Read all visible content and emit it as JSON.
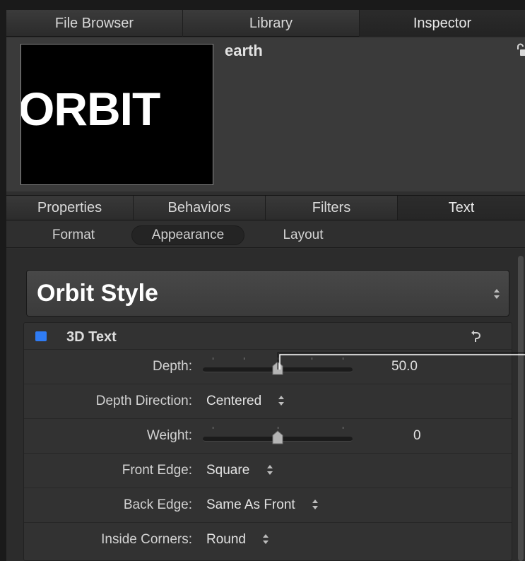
{
  "top_tabs": [
    {
      "label": "File Browser",
      "active": false
    },
    {
      "label": "Library",
      "active": false
    },
    {
      "label": "Inspector",
      "active": true
    }
  ],
  "preview": {
    "thumbnail_text": "ORBIT",
    "object_name": "earth",
    "lock_icon": "padlock-open-icon"
  },
  "pane_tabs": [
    {
      "label": "Properties",
      "active": false
    },
    {
      "label": "Behaviors",
      "active": false
    },
    {
      "label": "Filters",
      "active": false
    },
    {
      "label": "Text",
      "active": true
    }
  ],
  "sub_tabs": [
    {
      "label": "Format",
      "active": false
    },
    {
      "label": "Appearance",
      "active": true
    },
    {
      "label": "Layout",
      "active": false
    }
  ],
  "style_preset": {
    "name": "Orbit Style",
    "icon": "updown-arrows-icon"
  },
  "group": {
    "title": "3D Text",
    "enabled": true,
    "checkbox_color": "#2f7cf4",
    "reset_icon": "reset-arrow-icon",
    "rows": {
      "depth": {
        "label": "Depth:",
        "value": "50.0",
        "slider_fraction": 0.5
      },
      "depth_direction": {
        "label": "Depth Direction:",
        "value": "Centered"
      },
      "weight": {
        "label": "Weight:",
        "value": "0",
        "slider_fraction": 0.5
      },
      "front_edge": {
        "label": "Front Edge:",
        "value": "Square"
      },
      "back_edge": {
        "label": "Back Edge:",
        "value": "Same As Front"
      },
      "inside_corners": {
        "label": "Inside Corners:",
        "value": "Round"
      }
    }
  }
}
